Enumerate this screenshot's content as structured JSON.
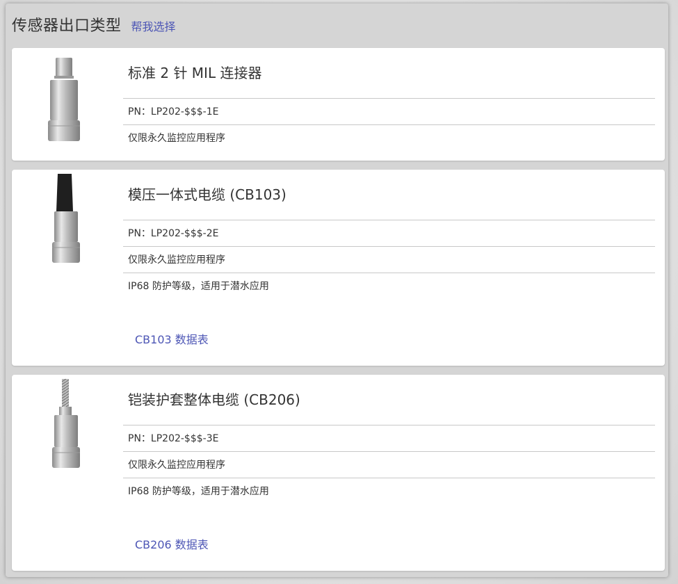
{
  "header": {
    "title": "传感器出口类型",
    "help_link": "帮我选择"
  },
  "cards": [
    {
      "title": "标准 2 针 MIL 连接器",
      "pn": "PN：LP202-$$$-1E",
      "note": "仅限永久监控应用程序",
      "image": "sensor-mil-connector"
    },
    {
      "title": "模压一体式电缆 (CB103)",
      "pn": "PN：LP202-$$$-2E",
      "note": "仅限永久监控应用程序",
      "extra": "IP68 防护等级，适用于潜水应用",
      "datasheet": "CB103 数据表",
      "image": "sensor-molded-cable"
    },
    {
      "title": "铠装护套整体电缆 (CB206)",
      "pn": "PN：LP202-$$$-3E",
      "note": "仅限永久监控应用程序",
      "extra": "IP68 防护等级，适用于潜水应用",
      "datasheet": "CB206 数据表",
      "image": "sensor-armored-cable"
    }
  ],
  "colors": {
    "link": "#4d56b5",
    "panel": "#d5d5d5",
    "divider": "#c8c8c8"
  }
}
